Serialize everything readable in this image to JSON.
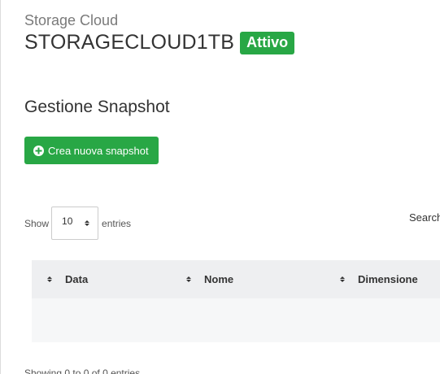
{
  "header": {
    "subtitle": "Storage Cloud",
    "title": "STORAGECLOUD1TB",
    "status_badge": "Attivo"
  },
  "snapshot_section": {
    "heading": "Gestione Snapshot",
    "create_button_label": "Crea nuova snapshot",
    "create_button_icon": "plus-circle-icon"
  },
  "table_controls": {
    "show_label": "Show",
    "page_length_value": "10",
    "entries_label": "entries",
    "search_label": "Search"
  },
  "table": {
    "columns": [
      "Data",
      "Nome",
      "Dimensione"
    ],
    "rows": [],
    "info_text": "Showing 0 to 0 of 0 entries"
  },
  "colors": {
    "accent_green": "#28a745",
    "header_bg": "#eeeff1",
    "row_bg": "#f6f7f8"
  }
}
